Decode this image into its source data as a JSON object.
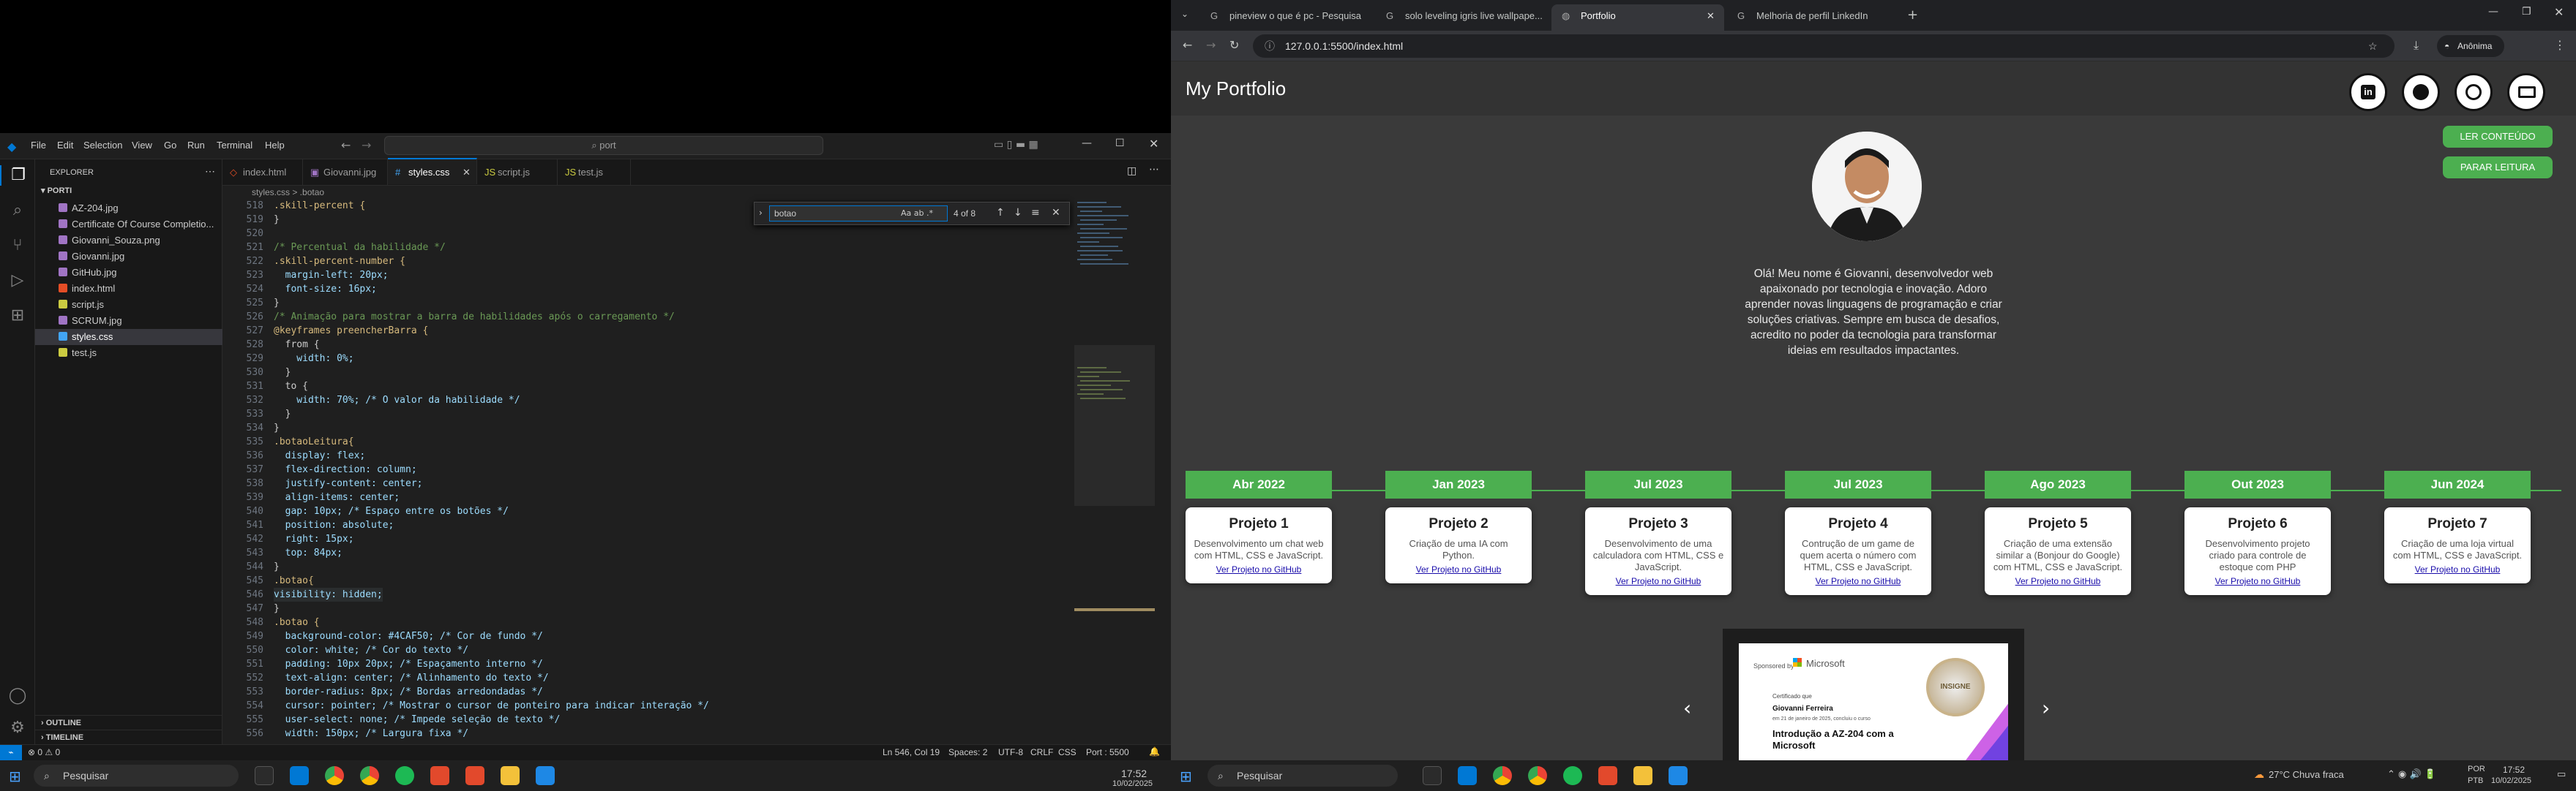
{
  "vscode": {
    "title_search": "port",
    "menu": [
      "File",
      "Edit",
      "Selection",
      "View",
      "Go",
      "Run",
      "Terminal",
      "Help"
    ],
    "explorer_title": "EXPLORER",
    "project": "PORTI",
    "files": [
      "AZ-204.jpg",
      "Certificate Of Course Completio...",
      "Giovanni_Souza.png",
      "Giovanni.jpg",
      "GitHub.jpg",
      "index.html",
      "script.js",
      "SCRUM.jpg",
      "styles.css",
      "test.js"
    ],
    "outline": "OUTLINE",
    "timeline": "TIMELINE",
    "tabs": [
      "index.html",
      "Giovanni.jpg",
      "styles.css",
      "script.js",
      "test.js"
    ],
    "breadcrumb": "styles.css > .botao",
    "find": {
      "query": "botao",
      "result": "4 of 8"
    },
    "line_numbers": [
      "518",
      "519",
      "520",
      "521",
      "522",
      "523",
      "524",
      "525",
      "526",
      "527",
      "528",
      "529",
      "530",
      "531",
      "532",
      "533",
      "534",
      "535",
      "536",
      "537",
      "538",
      "539",
      "540",
      "541",
      "542",
      "543",
      "544",
      "545",
      "546",
      "547",
      "548",
      "549",
      "550",
      "551",
      "552",
      "553",
      "554",
      "555",
      "556"
    ],
    "code": [
      ".skill-percent {",
      "}",
      "",
      "/* Percentual da habilidade */",
      ".skill-percent-number {",
      "  margin-left: 20px;",
      "  font-size: 16px;",
      "}",
      "/* Animação para mostrar a barra de habilidades após o carregamento */",
      "@keyframes preencherBarra {",
      "  from {",
      "    width: 0%;",
      "  }",
      "  to {",
      "    width: 70%; /* O valor da habilidade */",
      "  }",
      "}",
      ".botaoLeitura{",
      "  display: flex;",
      "  flex-direction: column;",
      "  justify-content: center;",
      "  align-items: center;",
      "  gap: 10px; /* Espaço entre os botões */",
      "  position: absolute;",
      "  right: 15px;",
      "  top: 84px;",
      "}",
      ".botao{",
      "visibility: hidden;",
      "}",
      ".botao {",
      "  background-color: #4CAF50; /* Cor de fundo */",
      "  color: white; /* Cor do texto */",
      "  padding: 10px 20px; /* Espaçamento interno */",
      "  text-align: center; /* Alinhamento do texto */",
      "  border-radius: 8px; /* Bordas arredondadas */",
      "  cursor: pointer; /* Mostrar o cursor de ponteiro para indicar interação */",
      "  user-select: none; /* Impede seleção de texto */",
      "  width: 150px; /* Largura fixa */"
    ],
    "status": {
      "left": "⊗ 0 ⚠ 0",
      "position": "Ln 546, Col 19",
      "spaces": "Spaces: 2",
      "encoding": "UTF-8",
      "eol": "CRLF",
      "lang": "CSS",
      "port": "Port : 5500"
    }
  },
  "browser": {
    "tabs": [
      "pineview o que é pc - Pesquisa",
      "solo leveling igris live wallpape...",
      "Portfolio",
      "Melhoria de perfil LinkedIn"
    ],
    "url": "127.0.0.1:5500/index.html",
    "profile": "Anônima",
    "page": {
      "title": "My Portfolio",
      "btn_read": "LER CONTEÚDO",
      "btn_stop": "PARAR LEITURA",
      "bio": "Olá! Meu nome é Giovanni, desenvolvedor web apaixonado por tecnologia e inovação. Adoro aprender novas linguagens de programação e criar soluções criativas. Sempre em busca de desafios, acredito no poder da tecnologia para transformar ideias em resultados impactantes.",
      "timeline": [
        {
          "date": "Abr 2022",
          "title": "Projeto 1",
          "desc": "Desenvolvimento um chat web com HTML, CSS e JavaScript.",
          "link": "Ver Projeto no GitHub"
        },
        {
          "date": "Jan 2023",
          "title": "Projeto 2",
          "desc": "Criação de uma IA com Python.",
          "link": "Ver Projeto no GitHub"
        },
        {
          "date": "Jul 2023",
          "title": "Projeto 3",
          "desc": "Desenvolvimento de uma calculadora com HTML, CSS e JavaScript.",
          "link": "Ver Projeto no GitHub"
        },
        {
          "date": "Jul 2023",
          "title": "Projeto 4",
          "desc": "Contrução de um game de quem acerta o número com HTML, CSS e JavaScript.",
          "link": "Ver Projeto no GitHub"
        },
        {
          "date": "Ago 2023",
          "title": "Projeto 5",
          "desc": "Criação de uma extensão similar a (Bonjour do Google) com HTML, CSS e JavaScript.",
          "link": "Ver Projeto no GitHub"
        },
        {
          "date": "Out 2023",
          "title": "Projeto 6",
          "desc": "Desenvolvimento projeto criado para controle de estoque com PHP",
          "link": "Ver Projeto no GitHub"
        },
        {
          "date": "Jun 2024",
          "title": "Projeto 7",
          "desc": "Criação de uma loja virtual com HTML, CSS e JavaScript.",
          "link": "Ver Projeto no GitHub"
        }
      ],
      "certificate": {
        "sponsor": "Sponsored by",
        "brand": "Microsoft",
        "issued": "Certificado que",
        "name": "Giovanni Ferreira",
        "date_line": "em 21 de janeiro de 2025, concluiu o curso",
        "course": "Introdução a AZ-204 com a Microsoft",
        "seal": "INSIGNE"
      }
    }
  },
  "taskbar": {
    "search": "Pesquisar",
    "weather": "27°C Chuva fraca",
    "lang": "POR",
    "lang2": "PTB",
    "time": "17:52",
    "date": "10/02/2025"
  }
}
